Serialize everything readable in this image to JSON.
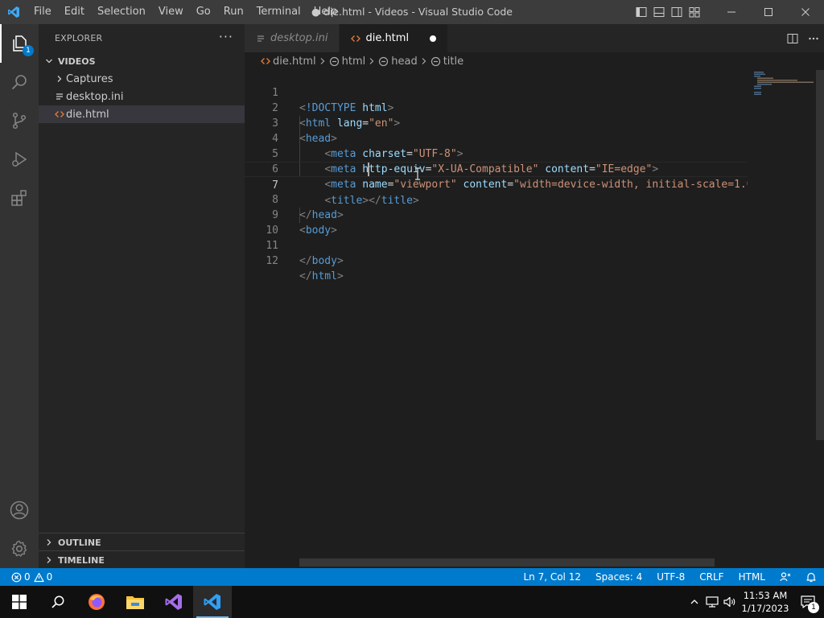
{
  "window": {
    "title": "● die.html - Videos - Visual Studio Code"
  },
  "menu": [
    "File",
    "Edit",
    "Selection",
    "View",
    "Go",
    "Run",
    "Terminal",
    "Help"
  ],
  "activity": {
    "explorer_badge": "1"
  },
  "sidebar": {
    "header": "EXPLORER",
    "more": "···",
    "folder": "VIDEOS",
    "items": [
      {
        "label": "Captures",
        "type": "folder"
      },
      {
        "label": "desktop.ini",
        "type": "file"
      },
      {
        "label": "die.html",
        "type": "html",
        "selected": true
      }
    ],
    "outline": "OUTLINE",
    "timeline": "TIMELINE"
  },
  "tabs": [
    {
      "label": "desktop.ini",
      "active": false
    },
    {
      "label": "die.html",
      "active": true
    }
  ],
  "breadcrumb": [
    "die.html",
    "html",
    "head",
    "title"
  ],
  "code": {
    "current_line": 7,
    "line_numbers": [
      "1",
      "2",
      "3",
      "4",
      "5",
      "6",
      "7",
      "8",
      "9",
      "10",
      "11",
      "12"
    ]
  },
  "status": {
    "errors": "0",
    "warnings": "0",
    "position": "Ln 7, Col 12",
    "spaces": "Spaces: 4",
    "encoding": "UTF-8",
    "eol": "CRLF",
    "language": "HTML"
  },
  "taskbar": {
    "time": "11:53 AM",
    "date": "1/17/2023",
    "notifications": "1"
  },
  "colors": {
    "accent": "#007acc",
    "titlebar": "#3c3c3c",
    "activitybar": "#333333",
    "sidebar": "#252526",
    "editor": "#1e1e1e"
  }
}
